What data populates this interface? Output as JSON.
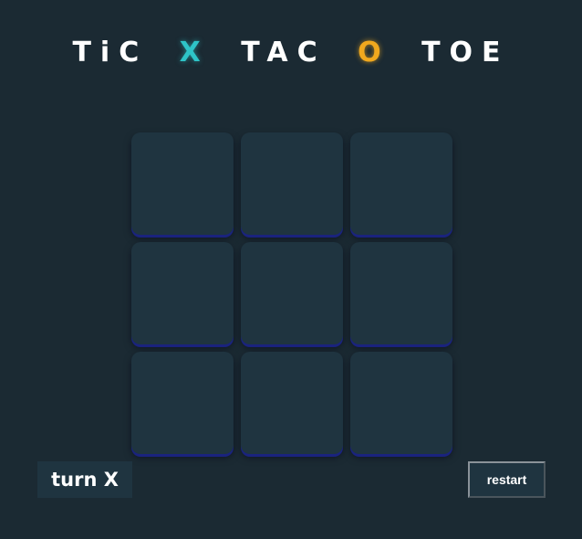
{
  "title": {
    "word1": "TiC",
    "x_mark": "X",
    "word2": "TAC",
    "o_mark": "O",
    "word3": "TOE"
  },
  "board": {
    "cells": [
      "",
      "",
      "",
      "",
      "",
      "",
      "",
      "",
      ""
    ]
  },
  "status": {
    "turn_text": "turn X"
  },
  "controls": {
    "restart_label": "restart"
  },
  "colors": {
    "background": "#1b2a33",
    "cell": "#1f3440",
    "x_accent": "#2ec4c7",
    "o_accent": "#f0a81e"
  }
}
